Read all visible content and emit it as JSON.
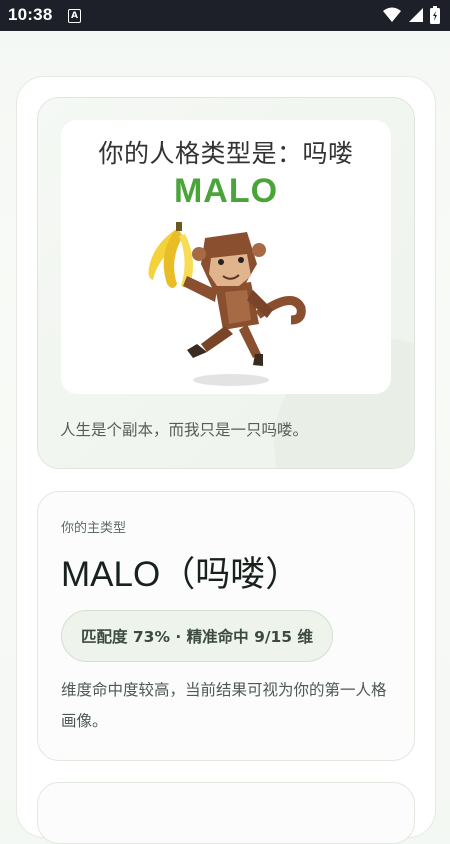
{
  "status_bar": {
    "time": "10:38",
    "notification_letter": "A"
  },
  "result_card": {
    "poster_title": "你的人格类型是：吗喽",
    "poster_code": "MALO",
    "quote": "人生是个副本，而我只是一只吗喽。"
  },
  "main_type_card": {
    "label": "你的主类型",
    "type_name": "MALO（吗喽）",
    "match_pill": "匹配度 73% · 精准命中 9/15 维",
    "description": "维度命中度较高，当前结果可视为你的第一人格画像。"
  },
  "icons": [
    "wifi-icon",
    "signal-icon",
    "battery-icon",
    "monkey-illustration",
    "banana-illustration"
  ],
  "colors": {
    "accent_green": "#4aa43a",
    "status_bar": "#1e2029"
  }
}
